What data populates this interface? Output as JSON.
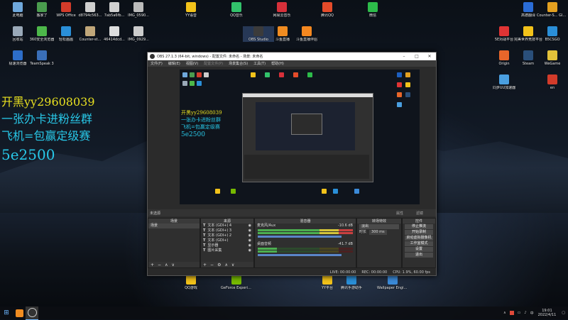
{
  "desktop": {
    "icons": [
      {
        "label": "此电脑",
        "color": "#6fa8dc"
      },
      {
        "label": "搬家了",
        "color": "#4a9c4e"
      },
      {
        "label": "WPS Office",
        "color": "#d23b2a"
      },
      {
        "label": "d8794c563...",
        "color": "#cfcfcf"
      },
      {
        "label": "7ab5a6fb...",
        "color": "#d0d0d0"
      },
      {
        "label": "IMG_0590...",
        "color": "#bbbbbb"
      },
      {
        "label": "YY语音",
        "color": "#f2c21a"
      },
      {
        "label": "QQ音乐",
        "color": "#32c26b"
      },
      {
        "label": "网易云音乐",
        "color": "#d7303a"
      },
      {
        "label": "腾讯QQ",
        "color": "#e44b2a"
      },
      {
        "label": "微信",
        "color": "#2dbb4a"
      },
      {
        "label": "回收站",
        "color": "#9aa9b8"
      },
      {
        "label": "360安全浏览器",
        "color": "#4db84a"
      },
      {
        "label": "轻松画画",
        "color": "#2a8fd8"
      },
      {
        "label": "Counter-st...",
        "color": "#c0a77a"
      },
      {
        "label": "46414dcd...",
        "color": "#dddddd"
      },
      {
        "label": "IMG_0929...",
        "color": "#cccccc"
      },
      {
        "label": "OBS Studio",
        "color": "#3b3b3b"
      },
      {
        "label": "斗鱼直播",
        "color": "#f08c21"
      },
      {
        "label": "斗鱼直播伴侣",
        "color": "#f58820"
      },
      {
        "label": "极速浏览器",
        "color": "#2d6ec9"
      },
      {
        "label": "TeamSpeak 3",
        "color": "#3a6fb8"
      },
      {
        "label": "高德翻译",
        "color": "#2a6cd6"
      },
      {
        "label": "Counter-S... Global Off...",
        "color": "#e3a020"
      },
      {
        "label": "5E对战平台",
        "color": "#e03434"
      },
      {
        "label": "完美世界竞技平台",
        "color": "#f2c21a"
      },
      {
        "label": "B5CSGO",
        "color": "#2a8fd8"
      },
      {
        "label": "Origin",
        "color": "#e8662a"
      },
      {
        "label": "Steam",
        "color": "#2a4f7a"
      },
      {
        "label": "WeGame",
        "color": "#e3c23a"
      },
      {
        "label": "同步UU加速器",
        "color": "#4a9fe0"
      },
      {
        "label": "en",
        "color": "#d23b2a"
      },
      {
        "label": "QQ游戏",
        "color": "#f2c21a"
      },
      {
        "label": "GeForce Experience",
        "color": "#76b900"
      },
      {
        "label": "YY平台",
        "color": "#f2c21a"
      },
      {
        "label": "腾讯手游助手",
        "color": "#2a8fd8"
      },
      {
        "label": "Wallpaper Engine: ...",
        "color": "#3b8ad8"
      }
    ],
    "promo_lines": [
      "开黑yy29608039",
      "一张办卡进粉丝群",
      "飞机=包赢定级赛",
      "5e2500"
    ]
  },
  "obs": {
    "title": "OBS 27.1.3 (64-bit, windows) - 配置文件: 未命名 - 场景: 未命名",
    "menu": [
      "文件(F)",
      "编辑(E)",
      "视图(V)",
      "配置文件(P)",
      "场景集合(S)",
      "工具(T)",
      "帮助(H)"
    ],
    "preview_promo": [
      "开黑yy29608039",
      "一张办卡进粉丝群",
      "飞机=包赢定级赛",
      "5e2500"
    ],
    "scene_bar": {
      "name": "未选源",
      "props": "属性",
      "filters": "滤镜"
    },
    "docks": {
      "scenes": {
        "title": "场景",
        "items": [
          "场景"
        ]
      },
      "sources": {
        "title": "来源",
        "items": [
          "文本 (GDI+) 4",
          "文本 (GDI+) 3",
          "文本 (GDI+) 2",
          "文本 (GDI+)",
          "显示器",
          "图片采集"
        ]
      },
      "mixer": {
        "title": "混音器",
        "channels": [
          {
            "name": "麦克风/Aux",
            "db": "-10.6 dB"
          },
          {
            "name": "桌面音频",
            "db": "-41.7 dB"
          }
        ]
      },
      "transitions": {
        "title": "转场特效",
        "type": "淡出",
        "duration_label": "时长",
        "duration": "300 ms"
      },
      "controls": {
        "title": "控件",
        "buttons": [
          "停止推流",
          "开始录制",
          "启动虚拟摄像机",
          "工作室模式",
          "设置",
          "退出"
        ]
      }
    },
    "status": {
      "live": "LIVE: 00:00:00",
      "rec": "REC: 00:00:00",
      "cpu": "CPU: 1.9%, 60.00 fps"
    }
  },
  "taskbar": {
    "time": "19:01",
    "date": "2022/4/11",
    "lang": "中"
  }
}
